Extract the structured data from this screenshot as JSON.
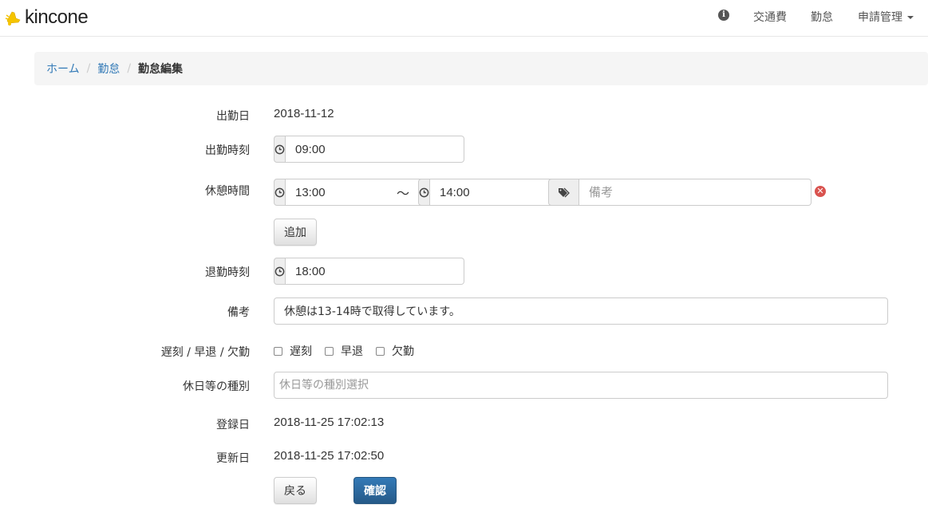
{
  "app": {
    "brand": "kincone"
  },
  "nav": {
    "info_icon": "info-icon",
    "transport_label": "交通費",
    "attendance_label": "勤怠",
    "requests_label": "申請管理"
  },
  "breadcrumb": {
    "home": "ホーム",
    "attendance": "勤怠",
    "current": "勤怠編集"
  },
  "form": {
    "work_date": {
      "label": "出勤日",
      "value": "2018-11-12"
    },
    "clock_in": {
      "label": "出勤時刻",
      "value": "09:00"
    },
    "break": {
      "label": "休憩時間",
      "start": "13:00",
      "separator": "〜",
      "end": "14:00",
      "note_placeholder": "備考"
    },
    "add_button": "追加",
    "clock_out": {
      "label": "退勤時刻",
      "value": "18:00"
    },
    "note": {
      "label": "備考",
      "value": "休憩は13-14時で取得しています。"
    },
    "flags": {
      "label": "遅刻 / 早退 / 欠勤",
      "options": [
        "遅刻",
        "早退",
        "欠勤"
      ]
    },
    "holiday_type": {
      "label": "休日等の種別",
      "placeholder": "休日等の種別選択"
    },
    "registered": {
      "label": "登録日",
      "value": "2018-11-25 17:02:13"
    },
    "updated": {
      "label": "更新日",
      "value": "2018-11-25 17:02:50"
    },
    "back_button": "戻る",
    "confirm_button": "確認"
  },
  "colors": {
    "link": "#337ab7",
    "primary": "#337ab7",
    "danger": "#d9534f",
    "brand_yellow": "#f5c400"
  }
}
